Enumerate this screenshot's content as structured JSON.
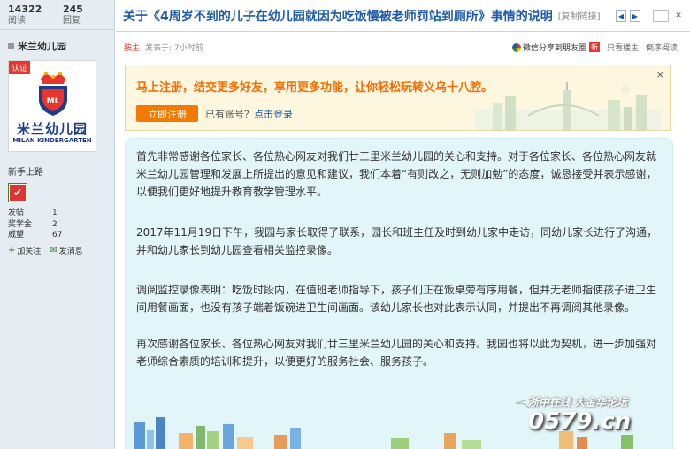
{
  "stats": {
    "views_value": "14322",
    "views_label": "阅读",
    "replies_value": "245",
    "replies_label": "回复"
  },
  "author": {
    "name": "米兰幼儿园",
    "verify_tag": "认证",
    "avatar_name": "米兰幼儿园",
    "avatar_en": "MILAN KINDERGARTEN",
    "avatar_badge": "ML"
  },
  "rank": {
    "title": "新手上路",
    "badge": "✔"
  },
  "profile": [
    {
      "key": "发帖",
      "value": "1"
    },
    {
      "key": "奖学金",
      "value": "2"
    },
    {
      "key": "威望",
      "value": "67"
    }
  ],
  "actions": {
    "follow": "加关注",
    "message": "发消息"
  },
  "thread": {
    "title": "关于《4周岁不到的儿子在幼儿园就因为吃饭慢被老师罚站到厕所》事情的说明",
    "copy_link": "[复制链接]"
  },
  "post_meta": {
    "floor": "胺主",
    "time": "发表于: 7小时前",
    "wechat_share": "微信分享到朋友圈",
    "new_tag": "新",
    "only_author": "只看楼主",
    "reverse": "倒序阅读"
  },
  "register": {
    "headline": "马上注册，结交更多好友，享用更多功能，让你轻松玩转义乌十八腔。",
    "button": "立即注册",
    "have_account": "已有账号？",
    "login_link": "点击登录",
    "close": "×"
  },
  "body": {
    "p1": "首先非常感谢各位家长、各位热心网友对我们廿三里米兰幼儿园的关心和支持。对于各位家长、各位热心网友就米兰幼儿园管理和发展上所提出的意见和建议，我们本着“有则改之，无则加勉”的态度，诚恳接受并表示感谢，以便我们更好地提升教育教学管理水平。",
    "p2": "2017年11月19日下午，我园与家长取得了联系，园长和班主任及时到幼儿家中走访，同幼儿家长进行了沟通，并和幼儿家长到幼儿园查看相关监控录像。",
    "p3": "调阅监控录像表明：吃饭时段内，在值班老师指导下，孩子们正在饭桌旁有序用餐，但并无老师指使孩子进卫生间用餐画面，也没有孩子端着饭碗进卫生间画面。该幼儿家长也对此表示认同，并提出不再调阅其他录像。",
    "p4": "再次感谢各位家长、各位热心网友对我们廿三里米兰幼儿园的关心和支持。我园也将以此为契机，进一步加强对老师综合素质的培训和提升，以便更好的服务社会、服务孩子。"
  },
  "watermark": {
    "line1": "浙中在线 大金华论坛",
    "line2": "0579.cn"
  },
  "colors": {
    "accent": "#1d5ba8",
    "orange": "#f27a00",
    "red": "#e8352e",
    "content_bg": "#e2f6f9"
  }
}
